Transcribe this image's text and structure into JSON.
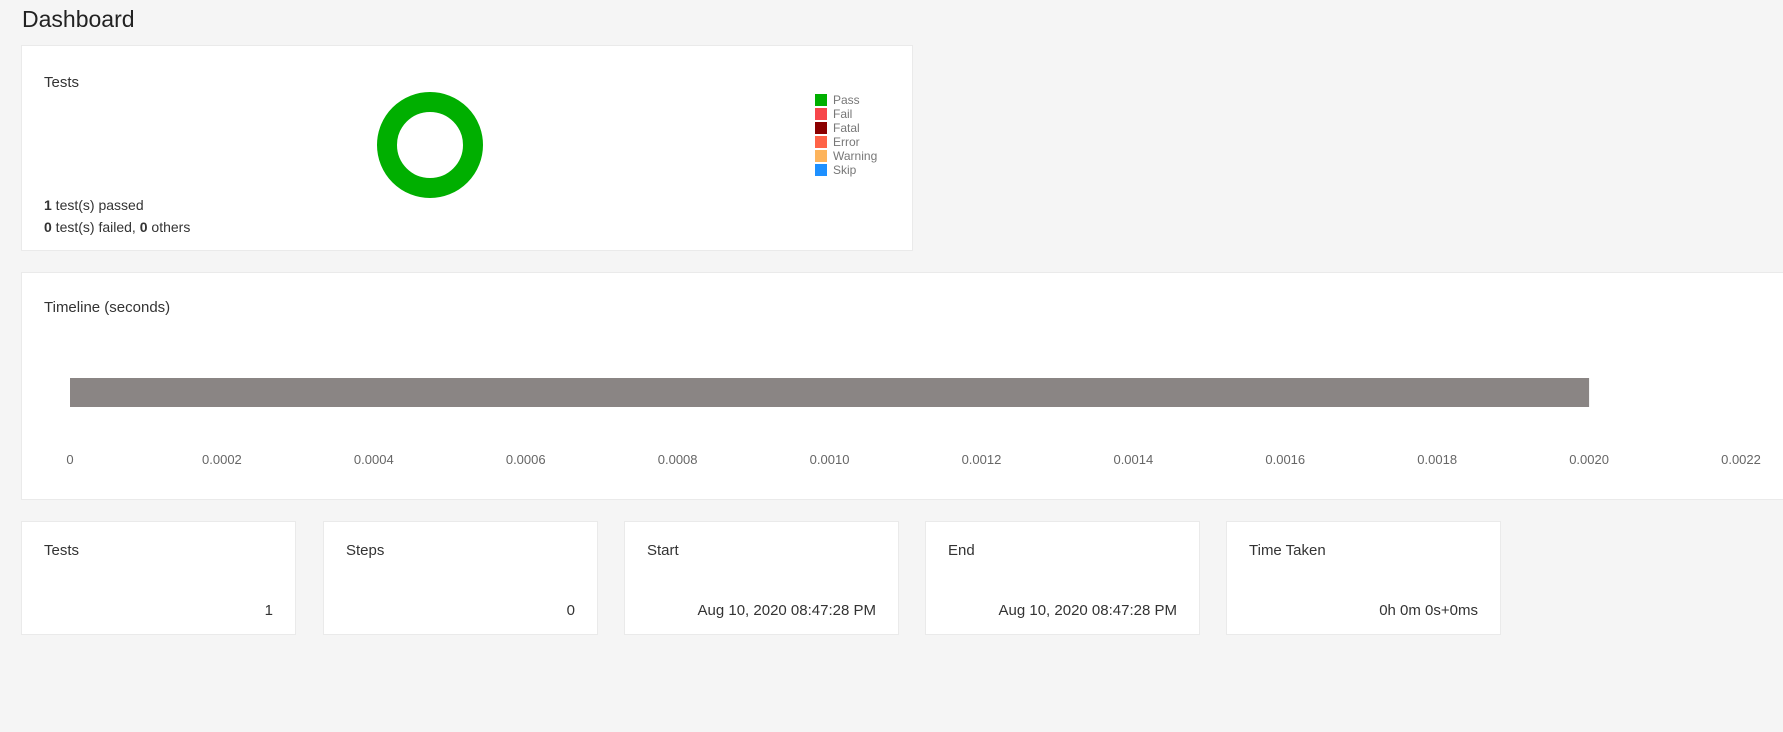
{
  "page_title": "Dashboard",
  "tests_card": {
    "title": "Tests",
    "donut": {
      "pass": 1,
      "fail": 0,
      "fatal": 0,
      "error": 0,
      "warning": 0,
      "skip": 0
    },
    "legend": [
      {
        "label": "Pass",
        "color": "#00af00"
      },
      {
        "label": "Fail",
        "color": "#f7464a"
      },
      {
        "label": "Fatal",
        "color": "#8b0000"
      },
      {
        "label": "Error",
        "color": "#ff6347"
      },
      {
        "label": "Warning",
        "color": "#fdb45c"
      },
      {
        "label": "Skip",
        "color": "#1e90ff"
      }
    ],
    "passed_count": "1",
    "passed_text": " test(s) passed",
    "failed_count": "0",
    "failed_text": " test(s) failed, ",
    "others_count": "0",
    "others_text": " others"
  },
  "timeline_card": {
    "title": "Timeline (seconds)"
  },
  "chart_data": {
    "type": "bar",
    "orientation": "horizontal",
    "title": "Timeline (seconds)",
    "series": [
      {
        "start": 0,
        "end": 0.002,
        "color": "#8a8584"
      }
    ],
    "xlim": [
      0,
      0.0022
    ],
    "ticks": [
      "0",
      "0.0002",
      "0.0004",
      "0.0006",
      "0.0008",
      "0.0010",
      "0.0012",
      "0.0014",
      "0.0016",
      "0.0018",
      "0.0020",
      "0.0022"
    ],
    "grid": false
  },
  "stats": [
    {
      "label": "Tests",
      "value": "1"
    },
    {
      "label": "Steps",
      "value": "0"
    },
    {
      "label": "Start",
      "value": "Aug 10, 2020 08:47:28 PM"
    },
    {
      "label": "End",
      "value": "Aug 10, 2020 08:47:28 PM"
    },
    {
      "label": "Time Taken",
      "value": "0h 0m 0s+0ms"
    }
  ]
}
